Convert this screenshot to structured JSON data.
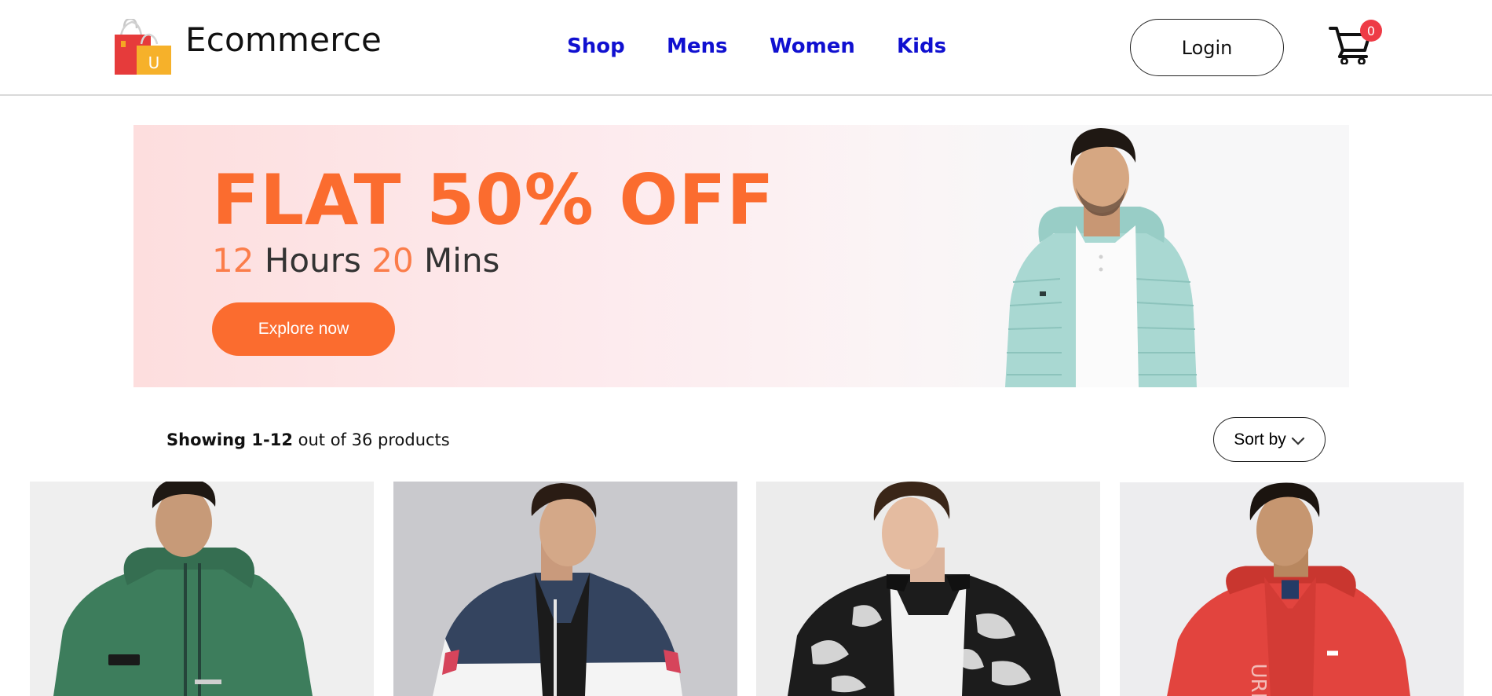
{
  "header": {
    "brand": "Ecommerce",
    "nav": [
      "Shop",
      "Mens",
      "Women",
      "Kids"
    ],
    "login_label": "Login",
    "cart_count": "0",
    "logo_letter": "U"
  },
  "banner": {
    "headline": "FLAT 50% OFF",
    "timer": {
      "hours": "12",
      "hours_label": "Hours",
      "mins": "20",
      "mins_label": "Mins"
    },
    "cta_label": "Explore now"
  },
  "listing": {
    "showing_range": "Showing 1-12",
    "showing_rest": " out of 36 products",
    "sort_label": "Sort by"
  },
  "colors": {
    "nav_link": "#1010d0",
    "accent_orange": "#fb6c2f",
    "cart_badge": "#ee3b46"
  },
  "icons": [
    "shopping-bag-logo-icon",
    "cart-icon",
    "chevron-down-icon"
  ],
  "products": [
    {
      "image": "green-hooded-jacket"
    },
    {
      "image": "navy-white-colorblock-jacket"
    },
    {
      "image": "black-white-print-bomber"
    },
    {
      "image": "red-hooded-jacket"
    }
  ]
}
